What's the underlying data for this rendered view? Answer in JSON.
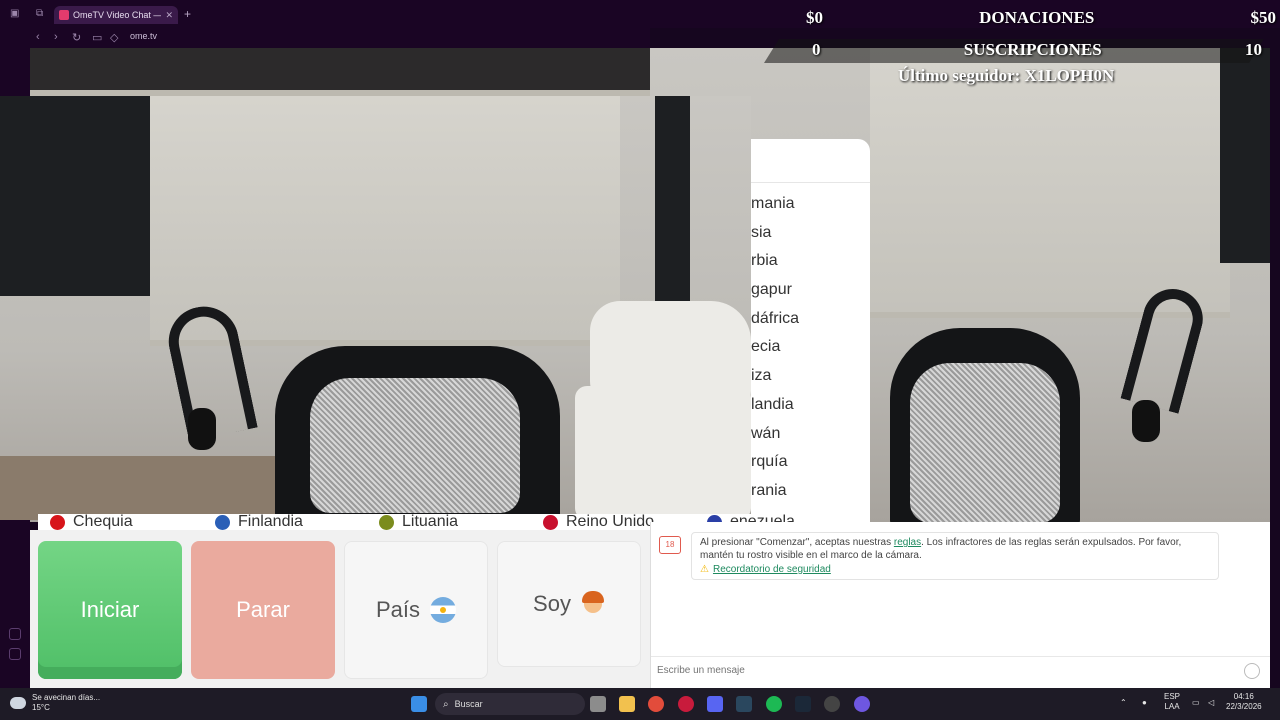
{
  "browser": {
    "tab_title": "OmeTV Video Chat —",
    "url": "ome.tv"
  },
  "stream_overlay": {
    "donations_left": "$0",
    "donations_label": "DONACIONES",
    "donations_right": "$50",
    "subs_left": "0",
    "subs_label": "SUSCRIPCIONES",
    "subs_right": "10",
    "follower_text": "Último seguidor: X1LOPH0N"
  },
  "country_list": [
    "mania",
    "sia",
    "rbia",
    "gapur",
    "dáfrica",
    "ecia",
    "iza",
    "landia",
    "wán",
    "rquía",
    "rania",
    "enezuela"
  ],
  "country_strip": {
    "items": [
      "Chequia",
      "Finlandia",
      "Lituania",
      "Reino Unido",
      "Venezuela"
    ],
    "colors": [
      "#d7141a",
      "#2a5fb7",
      "#7b8c1d",
      "#c8102e",
      "#2a3fa6"
    ]
  },
  "controls": {
    "start_label": "Iniciar",
    "stop_label": "Parar",
    "country_label": "País",
    "gender_label": "Soy"
  },
  "chat": {
    "notice_prefix": "Al presionar \"Comenzar\", aceptas nuestras ",
    "notice_link": "reglas",
    "notice_suffix": ". Los infractores de las reglas serán expulsados. Por favor, mantén tu rostro visible en el marco de la cámara.",
    "safety_link": "Recordatorio de seguridad",
    "input_placeholder": "Escribe un mensaje",
    "accent_color": "#1e8a5f"
  },
  "taskbar": {
    "weather_title": "Se avecinan días...",
    "weather_temp": "15°C",
    "search_label": "Buscar",
    "lang_top": "ESP",
    "lang_bottom": "LAA",
    "time": "04:16",
    "date": "22/3/2026"
  }
}
